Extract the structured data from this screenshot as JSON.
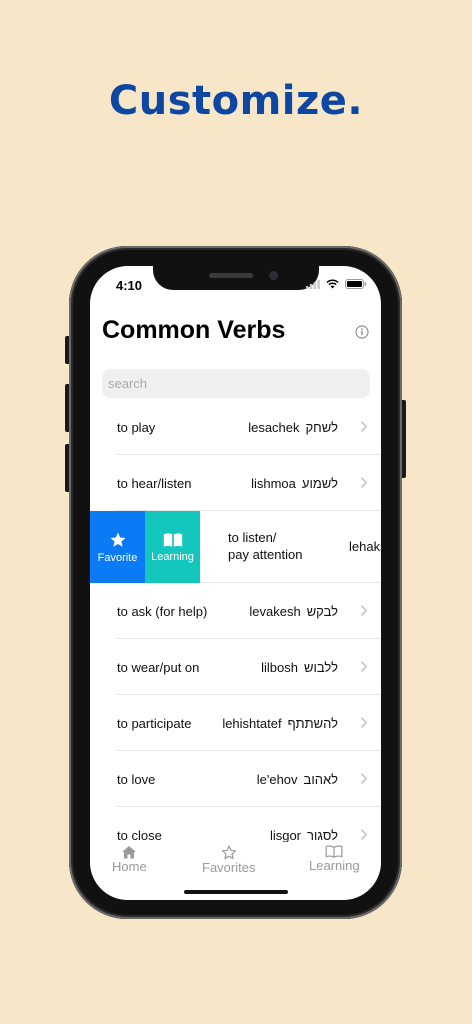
{
  "headline": "Customize.",
  "status_bar": {
    "time": "4:10"
  },
  "screen_title": "Common Verbs",
  "search": {
    "placeholder": "search",
    "value": ""
  },
  "verbs": [
    {
      "english": "to play",
      "translit": "lesachek",
      "hebrew": "לשחק"
    },
    {
      "english": "to hear/listen",
      "translit": "lishmoa",
      "hebrew": "לשמוע"
    }
  ],
  "swiped_row": {
    "english_line1": "to listen/",
    "english_line2": "pay attention",
    "translit_partial": "lehaks",
    "actions": [
      {
        "label": "Favorite",
        "icon": "star-icon",
        "color": "#0a7bf5"
      },
      {
        "label": "Learning",
        "icon": "book-icon",
        "color": "#14c7bd"
      }
    ]
  },
  "verbs_after": [
    {
      "english": "to ask (for help)",
      "translit": "levakesh",
      "hebrew": "לבקש"
    },
    {
      "english": "to wear/put on",
      "translit": "lilbosh",
      "hebrew": "ללבוש"
    },
    {
      "english": "to participate",
      "translit": "lehishtatef",
      "hebrew": "להשתתף"
    },
    {
      "english": "to love",
      "translit": "le'ehov",
      "hebrew": "לאהוב"
    },
    {
      "english": "to close",
      "translit": "lisgor",
      "hebrew": "לסגור"
    }
  ],
  "tabs": [
    {
      "label": "Home",
      "icon": "house-icon"
    },
    {
      "label": "Favorites",
      "icon": "star-outline-icon"
    },
    {
      "label": "Learning",
      "icon": "book-outline-icon"
    }
  ],
  "colors": {
    "background": "#f8e6c9",
    "headline": "#0d47a1",
    "favorite_action": "#0a7bf5",
    "learning_action": "#14c7bd"
  }
}
